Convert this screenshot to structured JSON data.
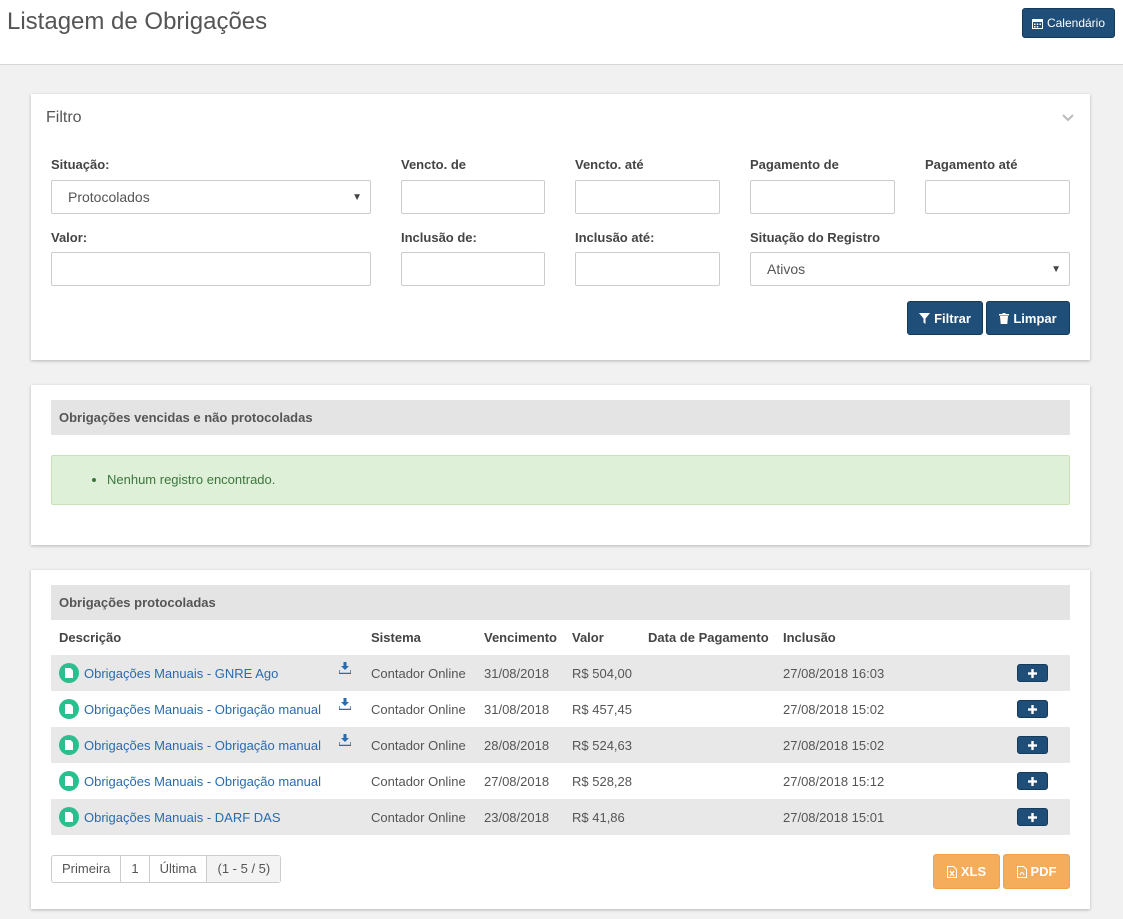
{
  "header": {
    "title": "Listagem de Obrigações",
    "calendar_label": "Calendário"
  },
  "filter": {
    "title": "Filtro",
    "situacao_label": "Situação:",
    "situacao_value": "Protocolados",
    "vencto_de_label": "Vencto. de",
    "vencto_ate_label": "Vencto. até",
    "pagamento_de_label": "Pagamento de",
    "pagamento_ate_label": "Pagamento até",
    "valor_label": "Valor:",
    "inclusao_de_label": "Inclusão de:",
    "inclusao_ate_label": "Inclusão até:",
    "situacao_registro_label": "Situação do Registro",
    "situacao_registro_value": "Ativos",
    "filtrar_label": "Filtrar",
    "limpar_label": "Limpar"
  },
  "vencidas": {
    "title": "Obrigações vencidas e não protocoladas",
    "message": "Nenhum registro encontrado."
  },
  "protocoladas": {
    "title": "Obrigações protocoladas",
    "columns": [
      "Descrição",
      "Sistema",
      "Vencimento",
      "Valor",
      "Data de Pagamento",
      "Inclusão"
    ],
    "rows": [
      {
        "descricao": "Obrigações Manuais - GNRE Ago",
        "download": true,
        "sistema": "Contador Online",
        "vencimento": "31/08/2018",
        "valor": "R$ 504,00",
        "pagamento": "",
        "inclusao": "27/08/2018 16:03"
      },
      {
        "descricao": "Obrigações Manuais - Obrigação manual",
        "download": true,
        "sistema": "Contador Online",
        "vencimento": "31/08/2018",
        "valor": "R$ 457,45",
        "pagamento": "",
        "inclusao": "27/08/2018 15:02"
      },
      {
        "descricao": "Obrigações Manuais - Obrigação manual",
        "download": true,
        "sistema": "Contador Online",
        "vencimento": "28/08/2018",
        "valor": "R$ 524,63",
        "pagamento": "",
        "inclusao": "27/08/2018 15:02"
      },
      {
        "descricao": "Obrigações Manuais - Obrigação manual",
        "download": false,
        "sistema": "Contador Online",
        "vencimento": "27/08/2018",
        "valor": "R$ 528,28",
        "pagamento": "",
        "inclusao": "27/08/2018 15:12"
      },
      {
        "descricao": "Obrigações Manuais - DARF DAS",
        "download": false,
        "sistema": "Contador Online",
        "vencimento": "23/08/2018",
        "valor": "R$ 41,86",
        "pagamento": "",
        "inclusao": "27/08/2018 15:01"
      }
    ],
    "pagination": {
      "first": "Primeira",
      "page": "1",
      "last": "Última",
      "info": "(1 - 5 / 5)"
    },
    "xls_label": "XLS",
    "pdf_label": "PDF"
  },
  "colors": {
    "primary": "#1f4e78",
    "orange": "#f5ad5b",
    "link": "#2a6bb0",
    "success_bg": "#dff0d8",
    "doc_icon": "#2bbf8f"
  },
  "icons": {
    "calendar": "calendar-icon",
    "filter": "filter-icon",
    "trash": "trash-icon",
    "download": "download-icon",
    "document": "document-icon",
    "plus": "plus-icon",
    "xls": "file-excel-icon",
    "pdf": "file-pdf-icon",
    "chevron": "chevron-down-icon"
  }
}
